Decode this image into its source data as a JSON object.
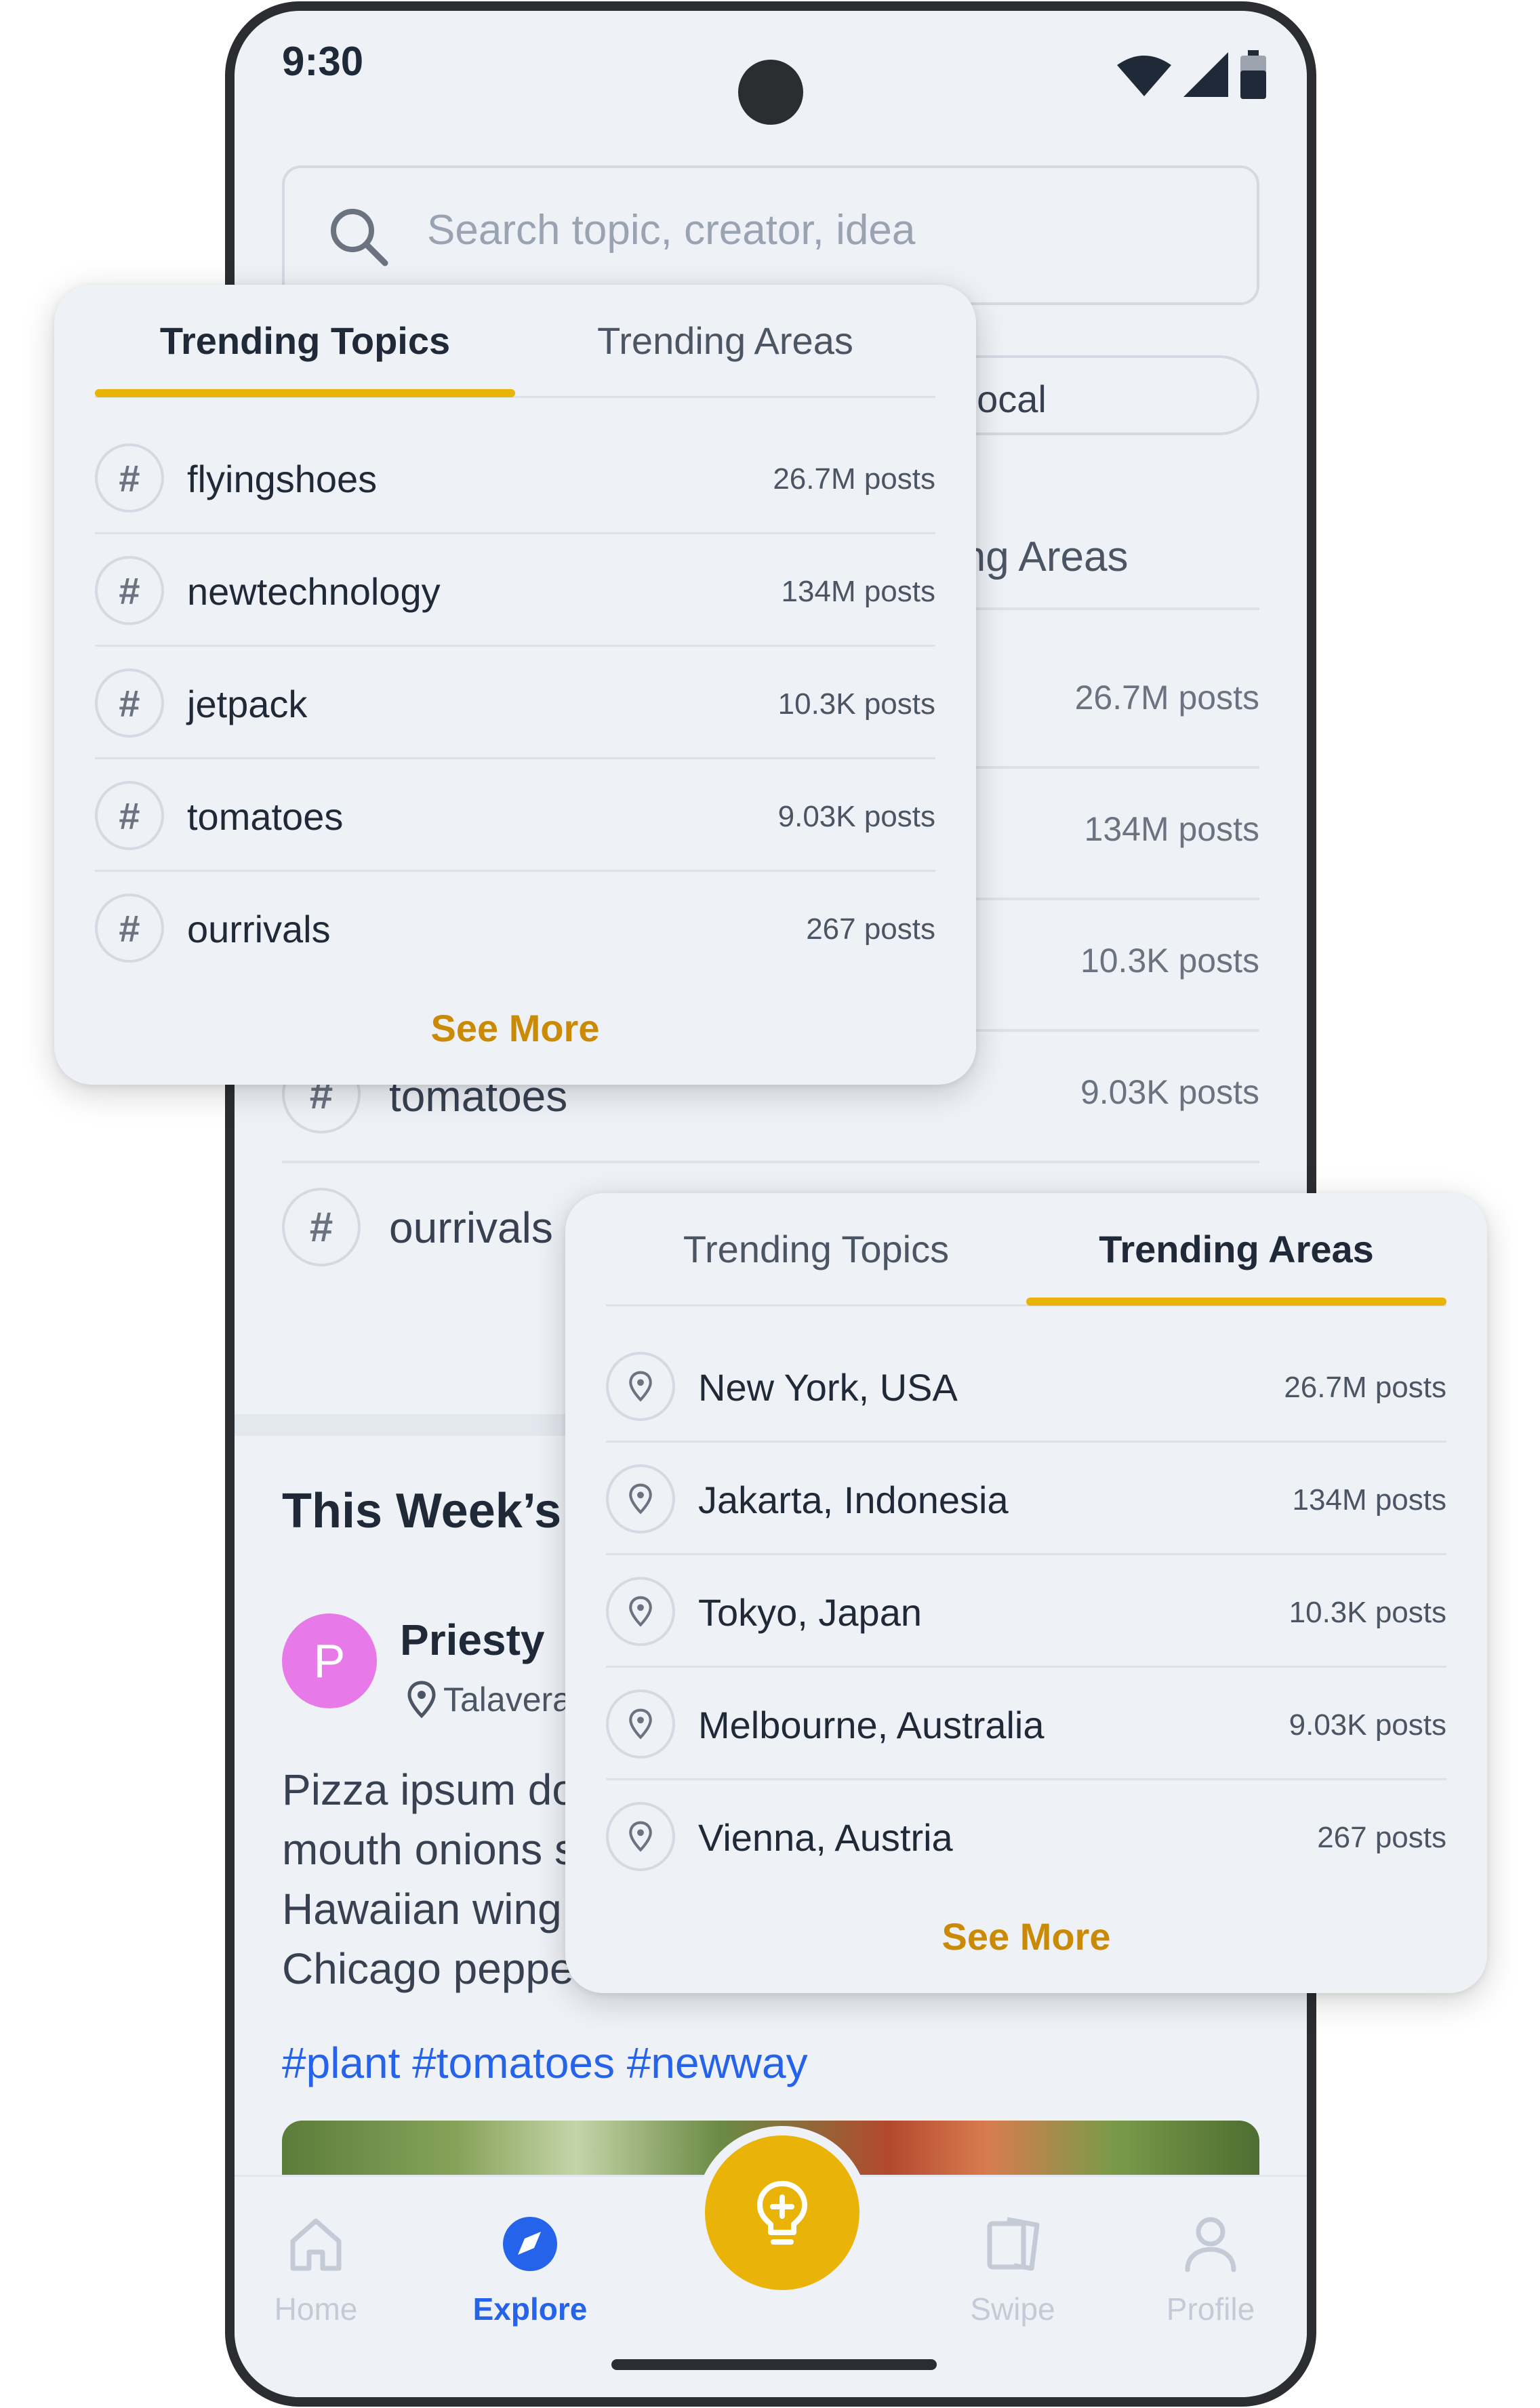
{
  "status_bar": {
    "time": "9:30"
  },
  "search": {
    "placeholder": "Search topic, creator, idea"
  },
  "background": {
    "chip_local": "Local",
    "tab_areas": "ing Areas",
    "rows": [
      {
        "count": "26.7M posts"
      },
      {
        "count": "134M posts"
      },
      {
        "count": "10.3K posts"
      },
      {
        "label": "tomatoes",
        "count": "9.03K posts"
      },
      {
        "label": "ourrivals"
      }
    ],
    "week_title": "This Week’s",
    "post": {
      "avatar_letter": "P",
      "author": "Priesty",
      "location": "Talavera",
      "text_lines": [
        "Pizza ipsum do",
        "mouth onions s",
        "Hawaiian wing",
        "Chicago peppe"
      ],
      "tags": "#plant #tomatoes #newway"
    }
  },
  "bottom_nav": {
    "items": [
      {
        "label": "Home",
        "icon": "home-icon"
      },
      {
        "label": "Explore",
        "icon": "compass-icon"
      },
      {
        "label": "Swipe",
        "icon": "cards-icon"
      },
      {
        "label": "Profile",
        "icon": "user-icon"
      }
    ],
    "fab_icon": "lightbulb-plus-icon"
  },
  "card_topics": {
    "tabs": [
      "Trending Topics",
      "Trending Areas"
    ],
    "active_tab": "Trending Topics",
    "rows": [
      {
        "label": "flyingshoes",
        "count": "26.7M posts"
      },
      {
        "label": "newtechnology",
        "count": "134M posts"
      },
      {
        "label": "jetpack",
        "count": "10.3K posts"
      },
      {
        "label": "tomatoes",
        "count": "9.03K posts"
      },
      {
        "label": "ourrivals",
        "count": "267 posts"
      }
    ],
    "see_more": "See More"
  },
  "card_areas": {
    "tabs": [
      "Trending Topics",
      "Trending Areas"
    ],
    "active_tab": "Trending Areas",
    "rows": [
      {
        "label": "New York, USA",
        "count": "26.7M posts"
      },
      {
        "label": "Jakarta, Indonesia",
        "count": "134M posts"
      },
      {
        "label": "Tokyo, Japan",
        "count": "10.3K posts"
      },
      {
        "label": "Melbourne, Australia",
        "count": "9.03K posts"
      },
      {
        "label": "Vienna, Austria",
        "count": "267 posts"
      }
    ],
    "see_more": "See More"
  },
  "colors": {
    "accent": "#eab308",
    "link": "#2563eb",
    "see_more": "#ca8a04",
    "background": "#eef1f6"
  }
}
